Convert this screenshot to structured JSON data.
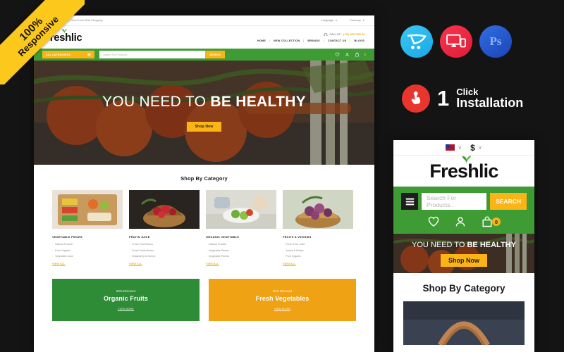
{
  "ribbon": {
    "line1": "100%",
    "line2": "Responsive"
  },
  "desktop": {
    "topbar": {
      "welcome": "Welcome To Electhic, Good Luck With Shopping",
      "language_label": "Language",
      "currency_label": "Currency",
      "caret": "▾"
    },
    "header": {
      "logo": "Frėshlic",
      "logo_plain": "Freshlic",
      "call_label": "CALL US :",
      "phone": "(+12) 345 7800 20",
      "nav": [
        "HOME",
        "NEW COLLECTION",
        "BRANDS",
        "CONTACT US",
        "BLOGS"
      ]
    },
    "searchbar": {
      "all_categories": "ALL CATEGORIES",
      "search_placeholder": "Search For Products...",
      "search_button": "SEARCH",
      "cart_count": "0"
    },
    "hero": {
      "title_thin": "YOU NEED TO",
      "title_bold": "BE HEALTHY",
      "button": "Shop Now"
    },
    "category_section": {
      "title": "Shop By Category",
      "view_all": "VIEW ALL",
      "columns": [
        {
          "heading": "VEGETABLE PIECES",
          "items": [
            "Natural Powder",
            "Pure Organic",
            "Vegetable Juice"
          ]
        },
        {
          "heading": "FRUITS JUICE",
          "items": [
            "Fresh Fruit Pieces",
            "Fresh Fruits Boxes",
            "Strawberry & Cherry"
          ]
        },
        {
          "heading": "ORGANIC VEGETABLE",
          "items": [
            "Natural Powder",
            "Vegetable Pieces",
            "Vegetable Purees"
          ]
        },
        {
          "heading": "FRUITS & VEGGIES",
          "items": [
            "Fresh Fruit Juice",
            "Juices & Drinks",
            "Pure Organic"
          ]
        }
      ]
    },
    "promos": [
      {
        "discount": "50% Discount",
        "title": "Organic Fruits",
        "link": "VIEW MORE",
        "color": "#2e8b36"
      },
      {
        "discount": "60% Discount",
        "title": "Fresh Vegetables",
        "link": "VIEW MORE",
        "color": "#f0a215"
      }
    ]
  },
  "right_rail": {
    "badges": [
      {
        "name": "opencart-badge",
        "color": "#1aa9e8"
      },
      {
        "name": "responsive-badge",
        "color": "#e01d3a"
      },
      {
        "name": "photoshop-badge",
        "label": "Ps",
        "color": "#1d43b8"
      }
    ],
    "one_click": {
      "number": "1",
      "line1": "Click",
      "line2": "Installation",
      "icon_color": "#e8352e"
    }
  },
  "mobile": {
    "topbar": {
      "currency_symbol": "$",
      "caret": "∨"
    },
    "logo": "Freshlic",
    "search": {
      "placeholder": "Search For Products..",
      "button": "SEARCH",
      "cart_count": "0"
    },
    "hero": {
      "title_thin": "YOU NEED TO",
      "title_bold": "BE HEALTHY",
      "button": "Shop Now"
    },
    "section_title": "Shop By Category"
  }
}
